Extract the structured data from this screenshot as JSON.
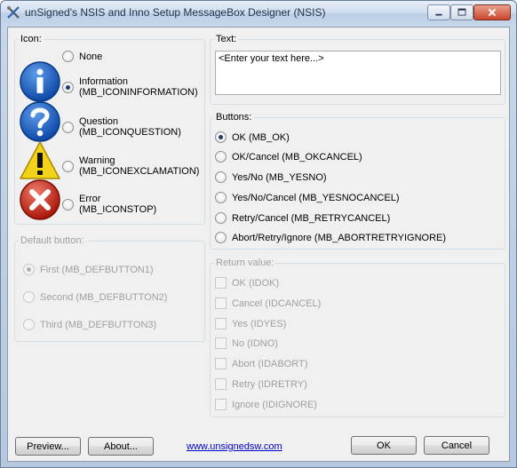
{
  "window": {
    "title": "unSigned's NSIS and Inno Setup MessageBox Designer (NSIS)"
  },
  "icon_group": {
    "legend": "Icon:",
    "options": [
      {
        "line1": "None",
        "line2": "",
        "checked": false,
        "icon": "none"
      },
      {
        "line1": "Information",
        "line2": "(MB_ICONINFORMATION)",
        "checked": true,
        "icon": "information-icon"
      },
      {
        "line1": "Question",
        "line2": "(MB_ICONQUESTION)",
        "checked": false,
        "icon": "question-icon"
      },
      {
        "line1": "Warning",
        "line2": "(MB_ICONEXCLAMATION)",
        "checked": false,
        "icon": "warning-icon"
      },
      {
        "line1": "Error",
        "line2": "(MB_ICONSTOP)",
        "checked": false,
        "icon": "error-icon"
      }
    ]
  },
  "default_button_group": {
    "legend": "Default button:",
    "options": [
      {
        "label": "First (MB_DEFBUTTON1)",
        "checked": true
      },
      {
        "label": "Second (MB_DEFBUTTON2)",
        "checked": false
      },
      {
        "label": "Third (MB_DEFBUTTON3)",
        "checked": false
      }
    ]
  },
  "text_group": {
    "legend": "Text:",
    "value": "<Enter your text here...>"
  },
  "buttons_group": {
    "legend": "Buttons:",
    "options": [
      {
        "label": "OK (MB_OK)",
        "checked": true
      },
      {
        "label": "OK/Cancel (MB_OKCANCEL)",
        "checked": false
      },
      {
        "label": "Yes/No (MB_YESNO)",
        "checked": false
      },
      {
        "label": "Yes/No/Cancel (MB_YESNOCANCEL)",
        "checked": false
      },
      {
        "label": "Retry/Cancel (MB_RETRYCANCEL)",
        "checked": false
      },
      {
        "label": "Abort/Retry/Ignore (MB_ABORTRETRYIGNORE)",
        "checked": false
      }
    ]
  },
  "return_group": {
    "legend": "Return value:",
    "options": [
      {
        "label": "OK (IDOK)"
      },
      {
        "label": "Cancel (IDCANCEL)"
      },
      {
        "label": "Yes (IDYES)"
      },
      {
        "label": "No (IDNO)"
      },
      {
        "label": "Abort (IDABORT)"
      },
      {
        "label": "Retry (IDRETRY)"
      },
      {
        "label": "Ignore (IDIGNORE)"
      }
    ]
  },
  "footer": {
    "preview_label": "Preview...",
    "about_label": "About...",
    "link_text": "www.unsignedsw.com",
    "ok_label": "OK",
    "cancel_label": "Cancel"
  },
  "colors": {
    "link": "#0000cc",
    "disabled_text": "#a0a0a0",
    "radio_dot": "#1f3c6a"
  }
}
